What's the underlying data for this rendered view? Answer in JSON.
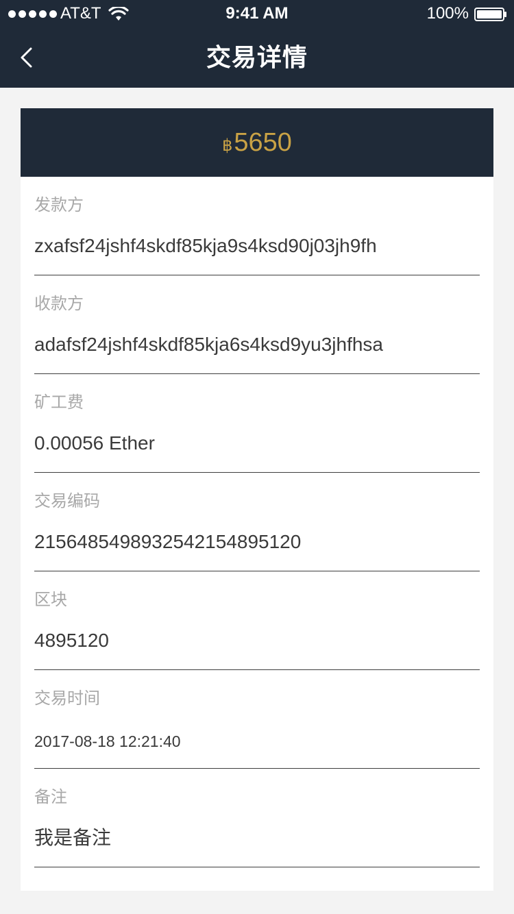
{
  "status_bar": {
    "carrier": "AT&T",
    "time": "9:41 AM",
    "battery_percent": "100%"
  },
  "nav": {
    "title": "交易详情",
    "back_icon": "chevron-left-icon"
  },
  "transaction": {
    "amount_symbol": "฿",
    "amount": "5650",
    "sender_label": "发款方",
    "sender_value": "zxafsf24jshf4skdf85kja9s4ksd90j03jh9fh",
    "receiver_label": "收款方",
    "receiver_value": "adafsf24jshf4skdf85kja6s4ksd9yu3jhfhsa",
    "fee_label": "矿工费",
    "fee_value": "0.00056 Ether",
    "tx_code_label": "交易编码",
    "tx_code_value": "21564854989325421548951​20",
    "block_label": "区块",
    "block_value": "4895120",
    "time_label": "交易时间",
    "time_value": "2017-08-18 12:21:40",
    "note_label": "备注",
    "note_value": "我是备注"
  },
  "colors": {
    "header_bg": "#1f2a38",
    "page_bg": "#f3f3f3",
    "amount_color": "#c9a245",
    "label_color": "#a8a8a8"
  }
}
